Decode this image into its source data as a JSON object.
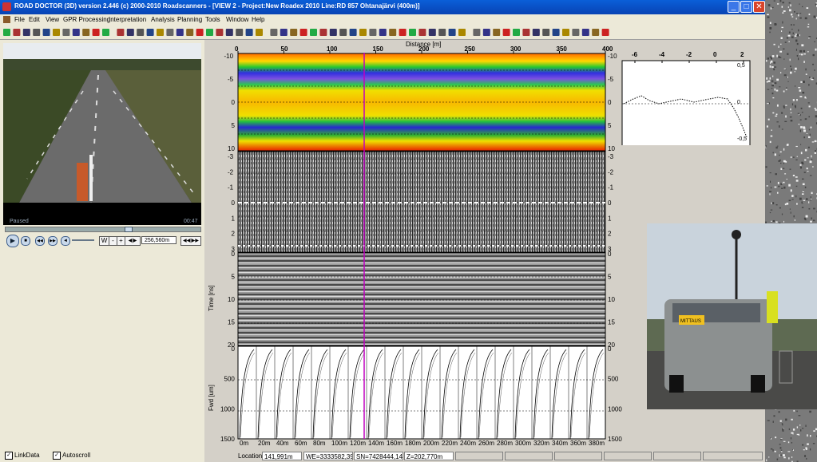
{
  "window": {
    "title": "ROAD DOCTOR (3D) version 2.446 (c) 2000-2010 Roadscanners - [VIEW 2 - Project:New Roadex 2010 Line:RD 857 Ohtanajärvi (400m)]",
    "minimize": "_",
    "restore": "□",
    "close": "✕"
  },
  "menu": [
    "File",
    "Edit",
    "View",
    "GPR Processing",
    "Interpretation",
    "Analysis",
    "Planning",
    "Tools",
    "Window",
    "Help"
  ],
  "video": {
    "status": "Paused",
    "time": "00:47",
    "position_value": "256,560m",
    "w_label": "W",
    "minus_label": "-",
    "plus_label": "+",
    "scrub_fraction": 0.63
  },
  "left_checkboxes": [
    {
      "label": "LinkData",
      "checked": true
    },
    {
      "label": "Autoscroll",
      "checked": true
    }
  ],
  "distance_axis": {
    "title": "Distance [m]",
    "ticks": [
      "0",
      "50",
      "100",
      "150",
      "200",
      "250",
      "300",
      "350",
      "400"
    ]
  },
  "panel1": {
    "left_ticks": [
      "-10",
      "-5",
      "0",
      "5",
      "10"
    ],
    "right_ticks": [
      "-10",
      "-5",
      "0",
      "5",
      "10"
    ]
  },
  "panel2": {
    "left_ticks": [
      "-3",
      "-2",
      "-1",
      "0",
      "1",
      "2",
      "3"
    ],
    "right_ticks": [
      "-3",
      "-2",
      "-1",
      "0",
      "1",
      "2",
      "3"
    ]
  },
  "panel3": {
    "ylabel": "Time [ns]",
    "left_ticks": [
      "0",
      "5",
      "10",
      "15",
      "20"
    ],
    "right_ticks": [
      "0",
      "5",
      "10",
      "15",
      "20"
    ]
  },
  "panel4": {
    "ylabel": "Fwd [um]",
    "left_ticks": [
      "0",
      "500",
      "1000",
      "1500"
    ],
    "right_ticks": [
      "0",
      "500",
      "1000",
      "1500"
    ],
    "x_labels": [
      "0m",
      "20m",
      "40m",
      "60m",
      "80m",
      "100m",
      "120m",
      "140m",
      "160m",
      "180m",
      "200m",
      "220m",
      "240m",
      "260m",
      "280m",
      "300m",
      "320m",
      "340m",
      "360m",
      "380m"
    ]
  },
  "side_chart": {
    "x_ticks": [
      "-6",
      "-4",
      "-2",
      "0",
      "2"
    ],
    "y_ticks": [
      "0,5",
      "0",
      "-0,5"
    ]
  },
  "status": {
    "location_label": "Location",
    "location_value": "141,991m",
    "we": "WE=3333582,391",
    "sn": "SN=7428444,147",
    "z": "Z=202,770m"
  },
  "photo": {
    "van_label": "MITTAUS"
  },
  "colors": {
    "cursor_line": "#c000c0",
    "titlebar": "#0a5fd8"
  }
}
